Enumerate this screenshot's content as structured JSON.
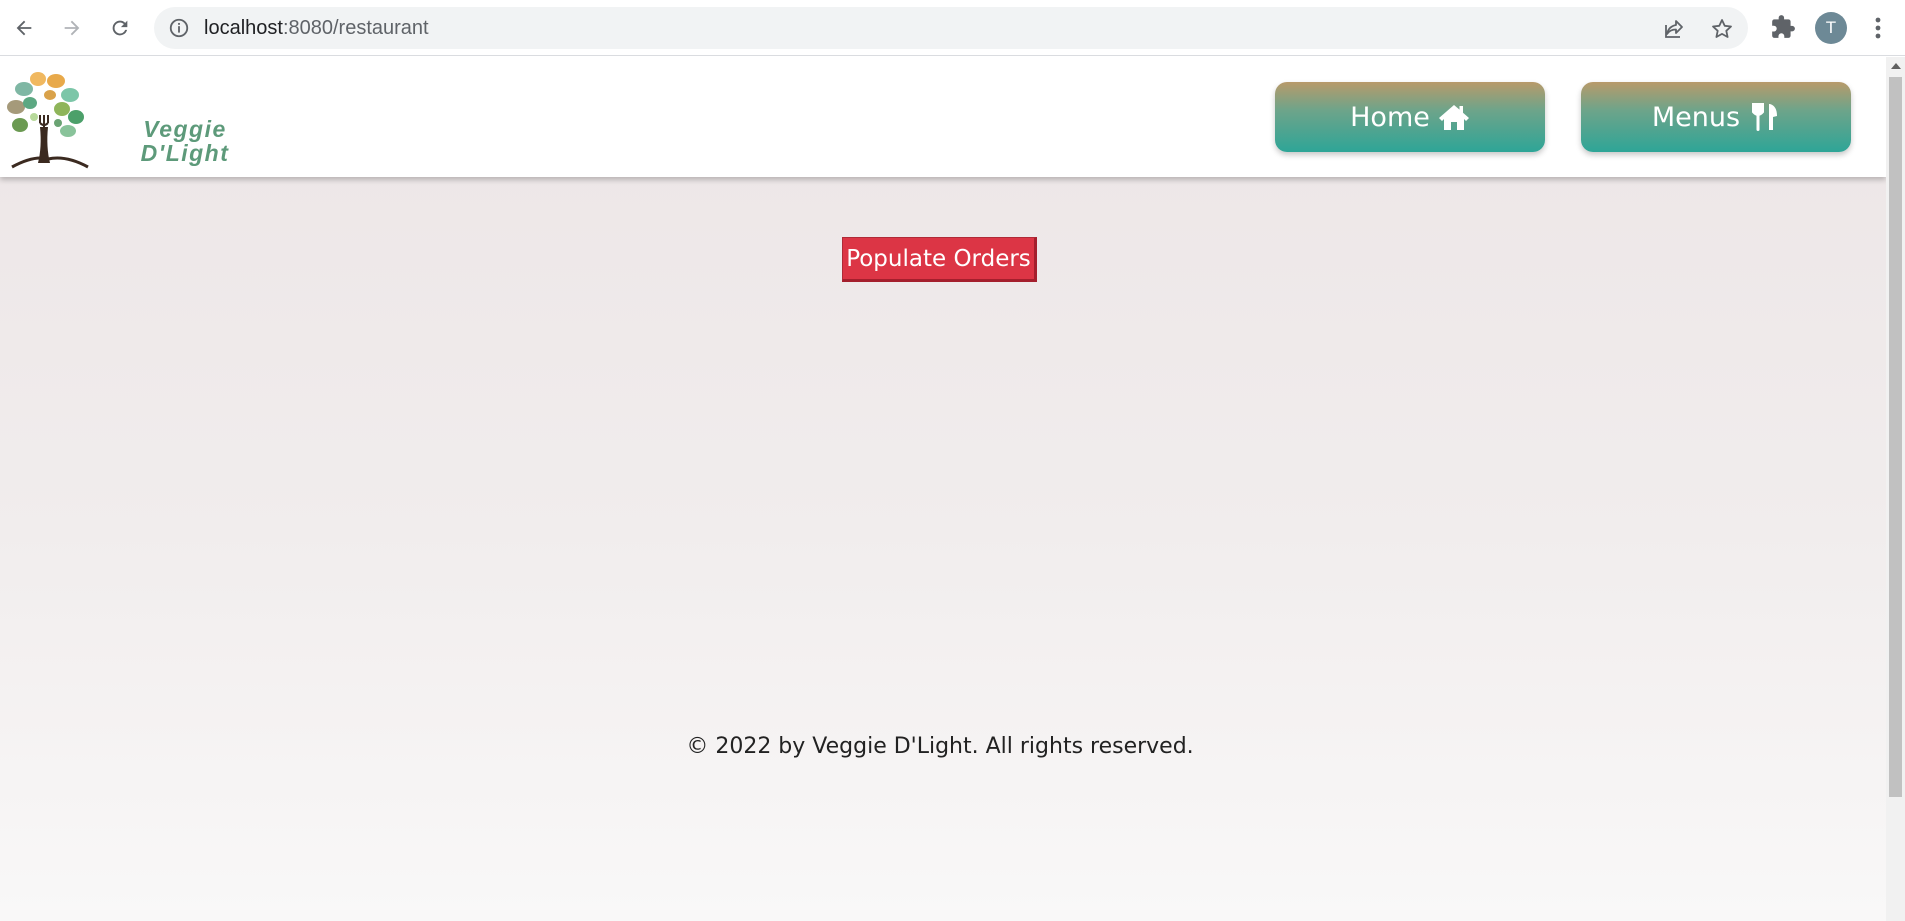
{
  "browser": {
    "url_host": "localhost",
    "url_path": ":8080/restaurant",
    "profile_initial": "T",
    "icons": {
      "back": "back-arrow-icon",
      "forward": "forward-arrow-icon",
      "reload": "reload-icon",
      "site_info": "info-icon",
      "share": "share-icon",
      "bookmark": "star-icon",
      "extensions": "puzzle-icon",
      "menu": "kebab-menu-icon"
    }
  },
  "header": {
    "brand_line1": "Veggie",
    "brand_line2": "D'Light",
    "nav": [
      {
        "label": "Home",
        "icon": "home-icon"
      },
      {
        "label": "Menus",
        "icon": "utensils-icon"
      }
    ]
  },
  "main": {
    "populate_button": "Populate Orders"
  },
  "footer": {
    "copyright": "© 2022 by Veggie D'Light. All rights reserved."
  },
  "colors": {
    "accent_red": "#dc3545",
    "nav_gradient_top": "#b89a6a",
    "nav_gradient_bottom": "#2ea597",
    "brand_green": "#5d9a7a"
  }
}
